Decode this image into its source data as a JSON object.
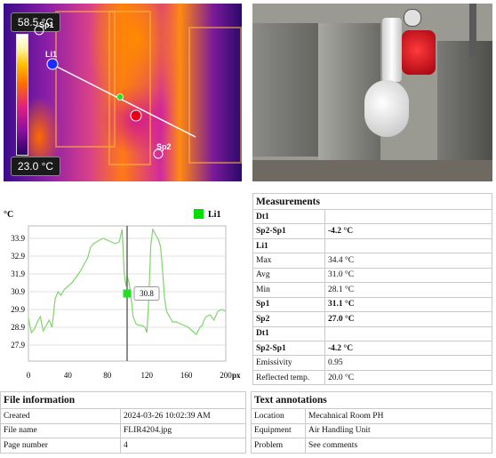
{
  "thermal_image": {
    "max_temp": "58.5 °C",
    "min_temp": "23.0 °C",
    "labels": {
      "sp1": "Sp1",
      "li1": "Li1",
      "sp2": "Sp2"
    }
  },
  "chart_data": {
    "type": "line",
    "title": "",
    "ylabel": "°C",
    "xlabel": "px",
    "legend": "Li1",
    "legend_color": "#00e000",
    "line_color": "#7fd46a",
    "ylim": [
      27.0,
      34.6
    ],
    "xlim": [
      0,
      200
    ],
    "x_ticks": [
      "0",
      "40",
      "80",
      "120",
      "160",
      "200"
    ],
    "y_ticks": [
      "27.9",
      "28.9",
      "29.9",
      "30.9",
      "31.9",
      "32.9",
      "33.9"
    ],
    "cursor": {
      "x": 100,
      "label": "30.8"
    },
    "x": [
      0,
      3,
      6,
      9,
      12,
      15,
      18,
      21,
      24,
      27,
      30,
      33,
      36,
      40,
      44,
      48,
      52,
      56,
      60,
      63,
      66,
      69,
      72,
      76,
      80,
      84,
      88,
      92,
      95,
      97,
      98,
      99,
      100,
      102,
      104,
      106,
      109,
      112,
      115,
      118,
      120,
      122,
      124,
      126,
      128,
      130,
      132,
      134,
      136,
      138,
      140,
      142,
      144,
      146,
      150,
      154,
      158,
      162,
      166,
      168,
      170,
      172,
      174,
      176,
      178,
      180,
      184,
      188,
      192,
      196,
      200
    ],
    "values": [
      29.4,
      28.6,
      28.8,
      29.2,
      29.5,
      28.7,
      29.0,
      29.3,
      28.9,
      30.5,
      30.9,
      30.7,
      31.0,
      31.2,
      31.4,
      31.7,
      32.0,
      32.4,
      32.8,
      33.4,
      33.6,
      33.7,
      33.8,
      33.9,
      33.8,
      33.7,
      33.6,
      33.7,
      34.4,
      32.0,
      31.5,
      31.2,
      31.8,
      31.4,
      30.6,
      29.5,
      29.1,
      29.0,
      29.0,
      28.9,
      28.6,
      30.5,
      33.5,
      34.4,
      34.2,
      34.0,
      33.8,
      33.4,
      32.0,
      30.5,
      29.8,
      29.6,
      29.4,
      29.2,
      29.2,
      29.1,
      29.0,
      28.9,
      28.7,
      28.6,
      28.5,
      28.7,
      28.9,
      29.0,
      29.3,
      29.5,
      29.6,
      29.3,
      29.8,
      29.9,
      29.8
    ]
  },
  "measurements": {
    "title": "Measurements",
    "rows": [
      {
        "label": "Dt1",
        "value": "",
        "bold": true
      },
      {
        "label": "Sp2-Sp1",
        "value": "-4.2 °C",
        "bold": true
      },
      {
        "label": "Li1",
        "value": "",
        "bold": true
      },
      {
        "label": "Max",
        "value": "34.4 °C",
        "bold": false
      },
      {
        "label": "Avg",
        "value": "31.0 °C",
        "bold": false
      },
      {
        "label": "Min",
        "value": "28.1 °C",
        "bold": false
      },
      {
        "label": "Sp1",
        "value": "31.1 °C",
        "bold": true
      },
      {
        "label": "Sp2",
        "value": "27.0 °C",
        "bold": true
      },
      {
        "label": "Dt1",
        "value": "",
        "bold": true
      },
      {
        "label": "Sp2-Sp1",
        "value": "-4.2 °C",
        "bold": true
      },
      {
        "label": "Emissivity",
        "value": "0.95",
        "bold": false
      },
      {
        "label": "Reflected temp.",
        "value": "20.0 °C",
        "bold": false
      }
    ]
  },
  "file_information": {
    "title": "File information",
    "rows": [
      {
        "label": "Created",
        "value": "2024-03-26 10:02:39 AM"
      },
      {
        "label": "File name",
        "value": "FLIR4204.jpg"
      },
      {
        "label": "Page number",
        "value": "4"
      }
    ]
  },
  "text_annotations": {
    "title": "Text annotations",
    "rows": [
      {
        "label": "Location",
        "value": "Mecahnical Room PH"
      },
      {
        "label": "Equipment",
        "value": "Air Handling Unit"
      },
      {
        "label": "Problem",
        "value": "See comments"
      }
    ]
  }
}
